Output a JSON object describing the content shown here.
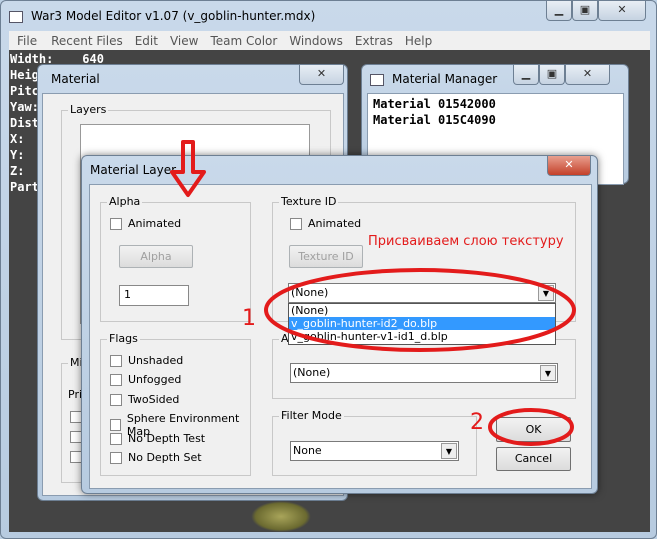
{
  "app": {
    "title": "War3 Model Editor v1.07 (v_goblin-hunter.mdx)",
    "menu": [
      "File",
      "Recent Files",
      "Edit",
      "View",
      "Team Color",
      "Windows",
      "Extras",
      "Help"
    ],
    "overlay": {
      "width_label": "Width:",
      "width_value": "640",
      "lines": [
        "Heigh",
        "Pitch",
        "Yaw:",
        "Dist",
        "X:",
        "Y:",
        "Z:",
        "Part:"
      ]
    }
  },
  "material_window": {
    "title": "Material",
    "layers_label": "Layers",
    "misc_label": "Mis",
    "priority_label": "Pri"
  },
  "material_manager": {
    "title": "Material Manager",
    "items": [
      "Material 01542000",
      "Material 015C4090"
    ]
  },
  "layer_dialog": {
    "title": "Material Layer",
    "alpha": {
      "label": "Alpha",
      "animated": "Animated",
      "button": "Alpha",
      "value": "1"
    },
    "flags": {
      "label": "Flags",
      "items": [
        "Unshaded",
        "Unfogged",
        "TwoSided",
        "Sphere Environment Map",
        "No Depth Test",
        "No Depth Set"
      ]
    },
    "texture": {
      "label": "Texture ID",
      "animated": "Animated",
      "button": "Texture ID",
      "selected": "(None)",
      "options": [
        "(None)",
        "v_goblin-hunter-id2_do.blp",
        "v_goblin-hunter-v1-id1_d.blp"
      ],
      "highlighted_index": 1
    },
    "second_group": {
      "label": "Al",
      "selected": "(None)"
    },
    "filter": {
      "label": "Filter Mode",
      "selected": "None"
    },
    "ok": "OK",
    "cancel": "Cancel"
  },
  "annotations": {
    "note": "Присваиваем слою текстуру",
    "step1": "1",
    "step2": "2",
    "color": "#e31b1b"
  },
  "colors": {
    "highlight": "#3399ff"
  }
}
